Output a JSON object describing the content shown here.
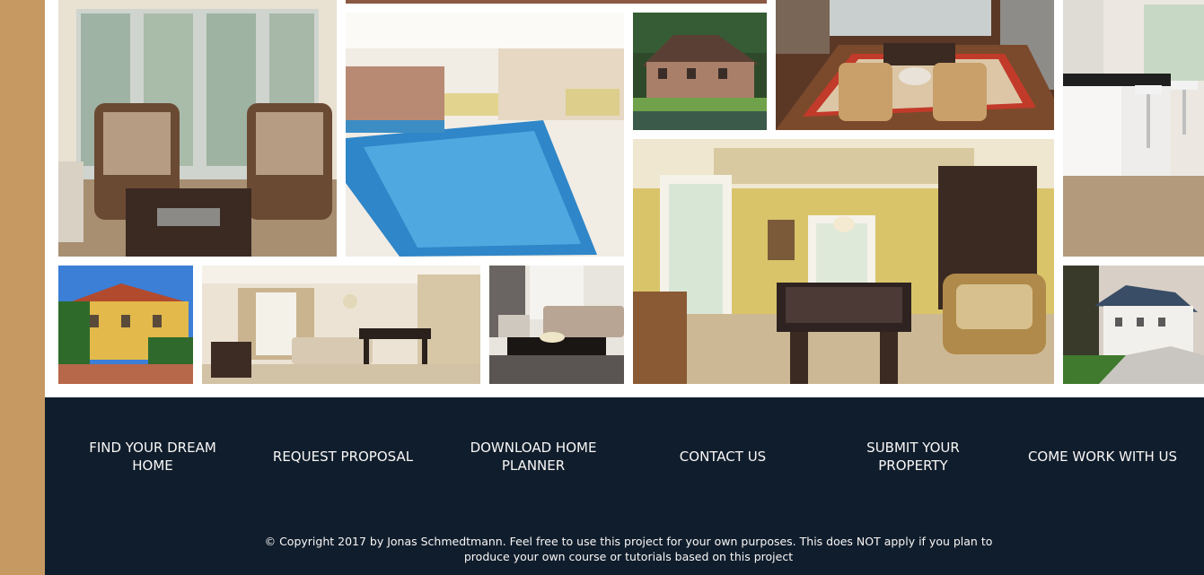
{
  "colors": {
    "sidebar": "#c69963",
    "footer_bg": "#101d2c",
    "footer_text": "#f9f7f6"
  },
  "gallery": {
    "images": [
      "living-room-armchairs",
      "indoor-pool",
      "house-lakeside",
      "lounge-fireplace",
      "kitchen-white",
      "billiard-room",
      "mediterranean-villa",
      "dining-living-room",
      "modern-lounge",
      "white-house-driveway"
    ]
  },
  "footer": {
    "nav": [
      "FIND YOUR DREAM HOME",
      "REQUEST PROPOSAL",
      "DOWNLOAD HOME PLANNER",
      "CONTACT US",
      "SUBMIT YOUR PROPERTY",
      "COME WORK WITH US"
    ],
    "copyright": "© Copyright 2017 by Jonas Schmedtmann. Feel free to use this project for your own purposes. This does NOT apply if you plan to produce your own course or tutorials based on this project"
  }
}
